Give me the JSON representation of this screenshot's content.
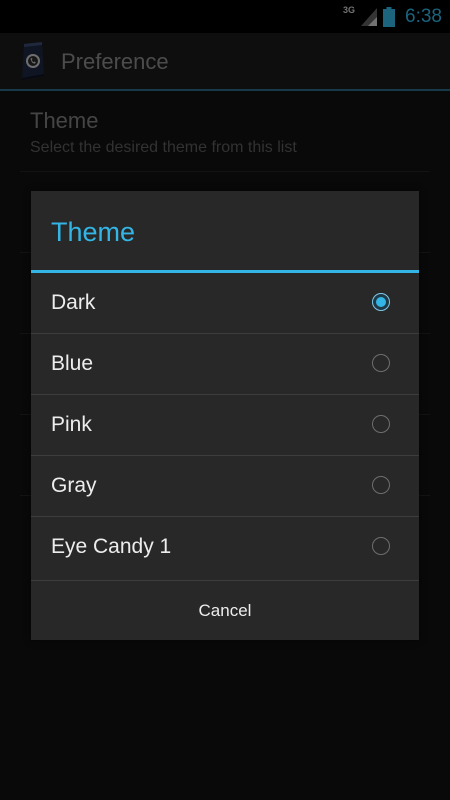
{
  "status_bar": {
    "network": "3G",
    "time": "6:38"
  },
  "action_bar": {
    "title": "Preference",
    "icon": "phone-app-icon"
  },
  "preference": {
    "title": "Theme",
    "summary": "Select the desired theme from this list"
  },
  "dialog": {
    "title": "Theme",
    "options": [
      {
        "label": "Dark",
        "checked": true
      },
      {
        "label": "Blue",
        "checked": false
      },
      {
        "label": "Pink",
        "checked": false
      },
      {
        "label": "Gray",
        "checked": false
      },
      {
        "label": "Eye Candy 1",
        "checked": false
      }
    ],
    "cancel_label": "Cancel"
  },
  "colors": {
    "accent": "#33b5e5",
    "dialog_bg": "#282828",
    "text": "#ededed"
  }
}
